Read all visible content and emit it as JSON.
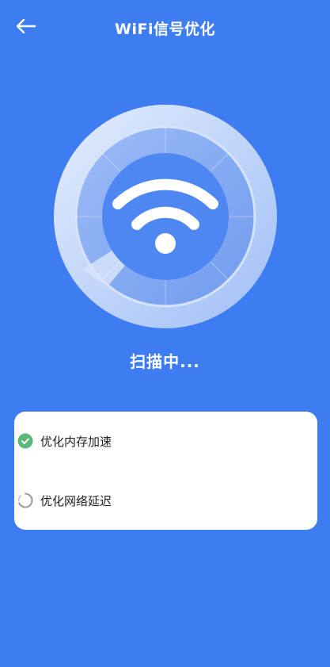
{
  "header": {
    "title": "WiFi信号优化",
    "back_icon": "arrow-left-icon"
  },
  "scan": {
    "status": "扫描中...",
    "icon": "wifi-icon"
  },
  "tasks": [
    {
      "label": "优化内存加速",
      "state": "done",
      "icon": "check-circle-icon"
    },
    {
      "label": "优化网络延迟",
      "state": "loading",
      "icon": "loading-spinner-icon"
    }
  ],
  "colors": {
    "background": "#3e7cf1",
    "card": "#ffffff",
    "success": "#5bb87a",
    "spinner": "#9a9a9a"
  }
}
